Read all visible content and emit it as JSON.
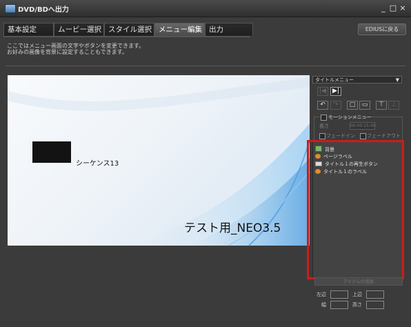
{
  "window": {
    "title": "DVD/BDへ出力",
    "controls": [
      "_",
      "□",
      "×"
    ]
  },
  "tabs": [
    {
      "label": "基本設定",
      "active": false
    },
    {
      "label": "ムービー選択",
      "active": false
    },
    {
      "label": "スタイル選択",
      "active": false
    },
    {
      "label": "メニュー編集",
      "active": true
    },
    {
      "label": "出力",
      "active": false
    }
  ],
  "back_button": "EDIUSに戻る",
  "description": [
    "ここではメニュー画面の文字やボタンを変更できます。",
    "お好みの画像を背景に設定することもできます。"
  ],
  "preview": {
    "sequence_label": "シーケンス13",
    "title_text": "テスト用_NEO3.5"
  },
  "panel": {
    "menu_select": "タイトルメニュー",
    "nav_buttons": [
      "|◀",
      "▶|"
    ],
    "edit_buttons": [
      "↶",
      "↷",
      "□",
      "▭",
      "⊤",
      "⊥"
    ],
    "motion_menu_label": "モーションメニュー",
    "length_label": "長さ",
    "length_value": "00:00:15:00",
    "fade_in_label": "フェードイン",
    "fade_out_label": "フェードアウト",
    "layers": [
      {
        "label": "背景",
        "icon": "image-icon"
      },
      {
        "label": "ページラベル",
        "icon": "text-label-icon"
      },
      {
        "label": "タイトル１の再生ボタン",
        "icon": "button-icon"
      },
      {
        "label": "タイトル１のラベル",
        "icon": "text-label-icon"
      }
    ],
    "disabled_button": "アイテムの追加",
    "coords": {
      "left_label": "左辺",
      "top_label": "上辺",
      "width_label": "幅",
      "height_label": "高さ"
    }
  },
  "colors": {
    "highlight": "#d11a1a",
    "background": "#3b3b3b"
  }
}
